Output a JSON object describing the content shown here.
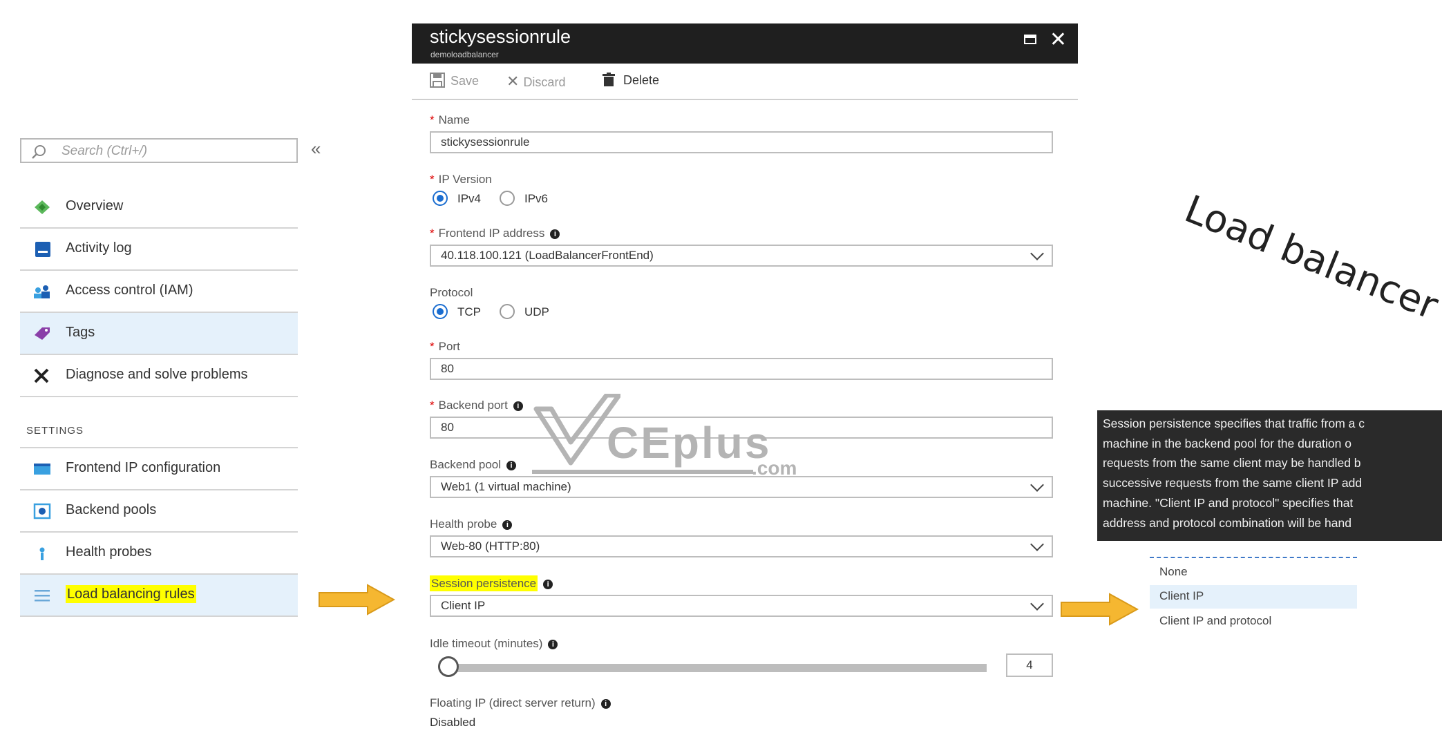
{
  "sidebar": {
    "search_placeholder": "Search (Ctrl+/)",
    "collapse": "«",
    "items": [
      {
        "label": "Overview",
        "icon": "overview-icon"
      },
      {
        "label": "Activity log",
        "icon": "activity-log-icon"
      },
      {
        "label": "Access control (IAM)",
        "icon": "iam-icon"
      },
      {
        "label": "Tags",
        "icon": "tag-icon"
      },
      {
        "label": "Diagnose and solve problems",
        "icon": "wrench-icon"
      }
    ],
    "section": "SETTINGS",
    "settings_items": [
      {
        "label": "Frontend IP configuration",
        "icon": "frontend-ip-icon"
      },
      {
        "label": "Backend pools",
        "icon": "backend-pools-icon"
      },
      {
        "label": "Health probes",
        "icon": "health-probe-icon"
      },
      {
        "label": "Load balancing rules",
        "icon": "list-icon"
      }
    ]
  },
  "blade": {
    "title": "stickysessionrule",
    "subtitle": "demoloadbalancer",
    "toolbar": {
      "save": "Save",
      "discard": "Discard",
      "delete": "Delete"
    },
    "name_label": "Name",
    "name_value": "stickysessionrule",
    "ip_version_label": "IP Version",
    "ipv4": "IPv4",
    "ipv6": "IPv6",
    "frontend_label": "Frontend IP address",
    "frontend_value": "40.118.100.121 (LoadBalancerFrontEnd)",
    "protocol_label": "Protocol",
    "tcp": "TCP",
    "udp": "UDP",
    "port_label": "Port",
    "port_value": "80",
    "backend_port_label": "Backend port",
    "backend_port_value": "80",
    "backend_pool_label": "Backend pool",
    "backend_pool_value": "Web1 (1 virtual machine)",
    "health_probe_label": "Health probe",
    "health_probe_value": "Web-80 (HTTP:80)",
    "session_label": "Session persistence",
    "session_value": "Client IP",
    "idle_label": "Idle timeout (minutes)",
    "idle_value": "4",
    "idle_level": 0,
    "floating_label": "Floating IP (direct server return)",
    "floating_value": "Disabled"
  },
  "tooltip": {
    "lines": [
      "Session persistence specifies that traffic from a c",
      "machine in the backend pool for the duration o",
      "requests from the same client may be handled b",
      "successive requests from the same client IP add",
      "machine. \"Client IP and protocol\" specifies that",
      "address and protocol combination will be hand"
    ]
  },
  "dropdown": {
    "options": [
      "None",
      "Client IP",
      "Client IP and protocol"
    ],
    "selected": "Client IP"
  },
  "watermark": {
    "brand": "CEplus",
    "suffix": ".com"
  },
  "handwritten": "Load balancer c",
  "colors": {
    "accent": "#1a6dd0",
    "highlight": "#ffff00",
    "arrow": "#f5b731",
    "selected_bg": "#e5f1fb"
  }
}
